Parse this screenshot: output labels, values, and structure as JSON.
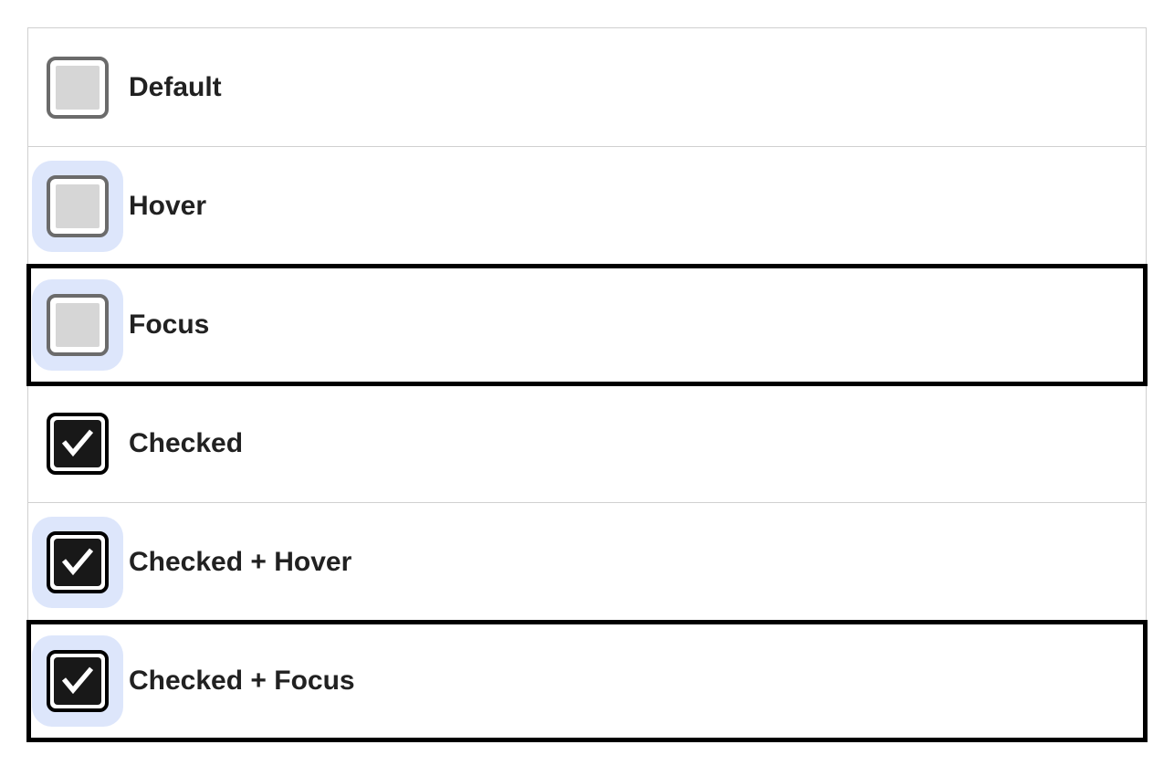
{
  "states": [
    {
      "label": "Default",
      "checked": false,
      "halo": false,
      "focus_ring": false
    },
    {
      "label": "Hover",
      "checked": false,
      "halo": true,
      "focus_ring": false
    },
    {
      "label": "Focus",
      "checked": false,
      "halo": true,
      "focus_ring": true
    },
    {
      "label": "Checked",
      "checked": true,
      "halo": false,
      "focus_ring": false
    },
    {
      "label": "Checked + Hover",
      "checked": true,
      "halo": true,
      "focus_ring": false
    },
    {
      "label": "Checked + Focus",
      "checked": true,
      "halo": true,
      "focus_ring": true
    }
  ],
  "colors": {
    "halo": "#dde6fb",
    "unchecked_border": "#6b6b6b",
    "unchecked_fill": "#d6d6d6",
    "checked_border": "#000000",
    "checked_fill": "#181818",
    "focus_outline": "#000000",
    "row_border": "#d0d0d0",
    "text": "#212121"
  }
}
